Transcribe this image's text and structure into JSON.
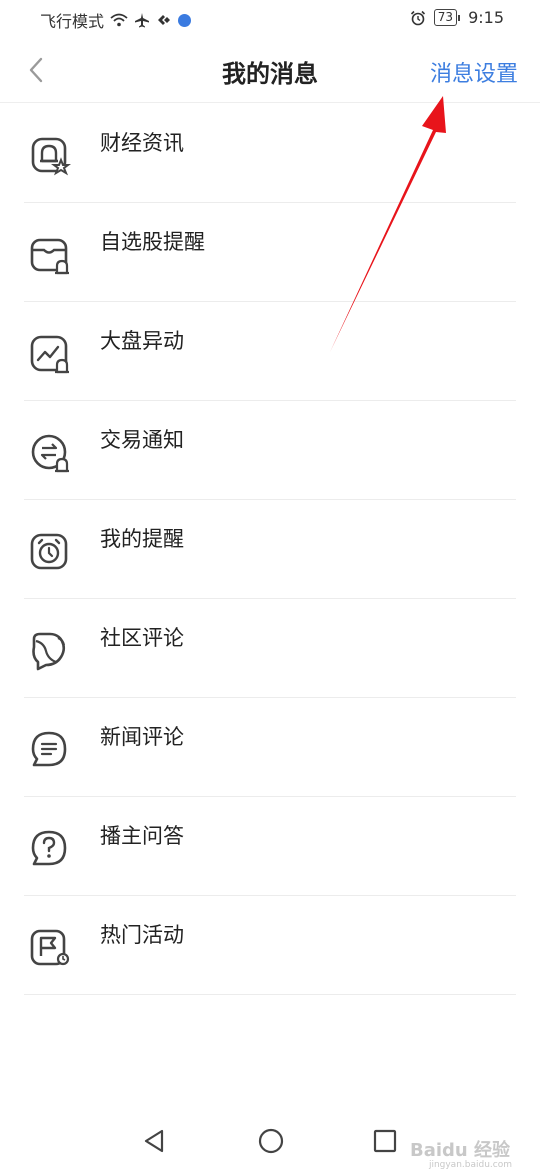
{
  "status_bar": {
    "mode_text": "飞行模式",
    "battery": "73",
    "time": "9:15"
  },
  "header": {
    "title": "我的消息",
    "settings_label": "消息设置"
  },
  "list": {
    "items": [
      {
        "label": "财经资讯",
        "icon": "bell-star-icon"
      },
      {
        "label": "自选股提醒",
        "icon": "folder-bell-icon"
      },
      {
        "label": "大盘异动",
        "icon": "chart-bell-icon"
      },
      {
        "label": "交易通知",
        "icon": "exchange-bell-icon"
      },
      {
        "label": "我的提醒",
        "icon": "alarm-clock-icon"
      },
      {
        "label": "社区评论",
        "icon": "community-chat-icon"
      },
      {
        "label": "新闻评论",
        "icon": "news-chat-icon"
      },
      {
        "label": "播主问答",
        "icon": "question-chat-icon"
      },
      {
        "label": "热门活动",
        "icon": "flag-activity-icon"
      }
    ]
  },
  "watermark": {
    "text": "Baidu 经验",
    "sub": "jingyan.baidu.com"
  },
  "colors": {
    "accent": "#3d7ee0",
    "arrow": "#e8141b",
    "icon_stroke": "#444444"
  }
}
